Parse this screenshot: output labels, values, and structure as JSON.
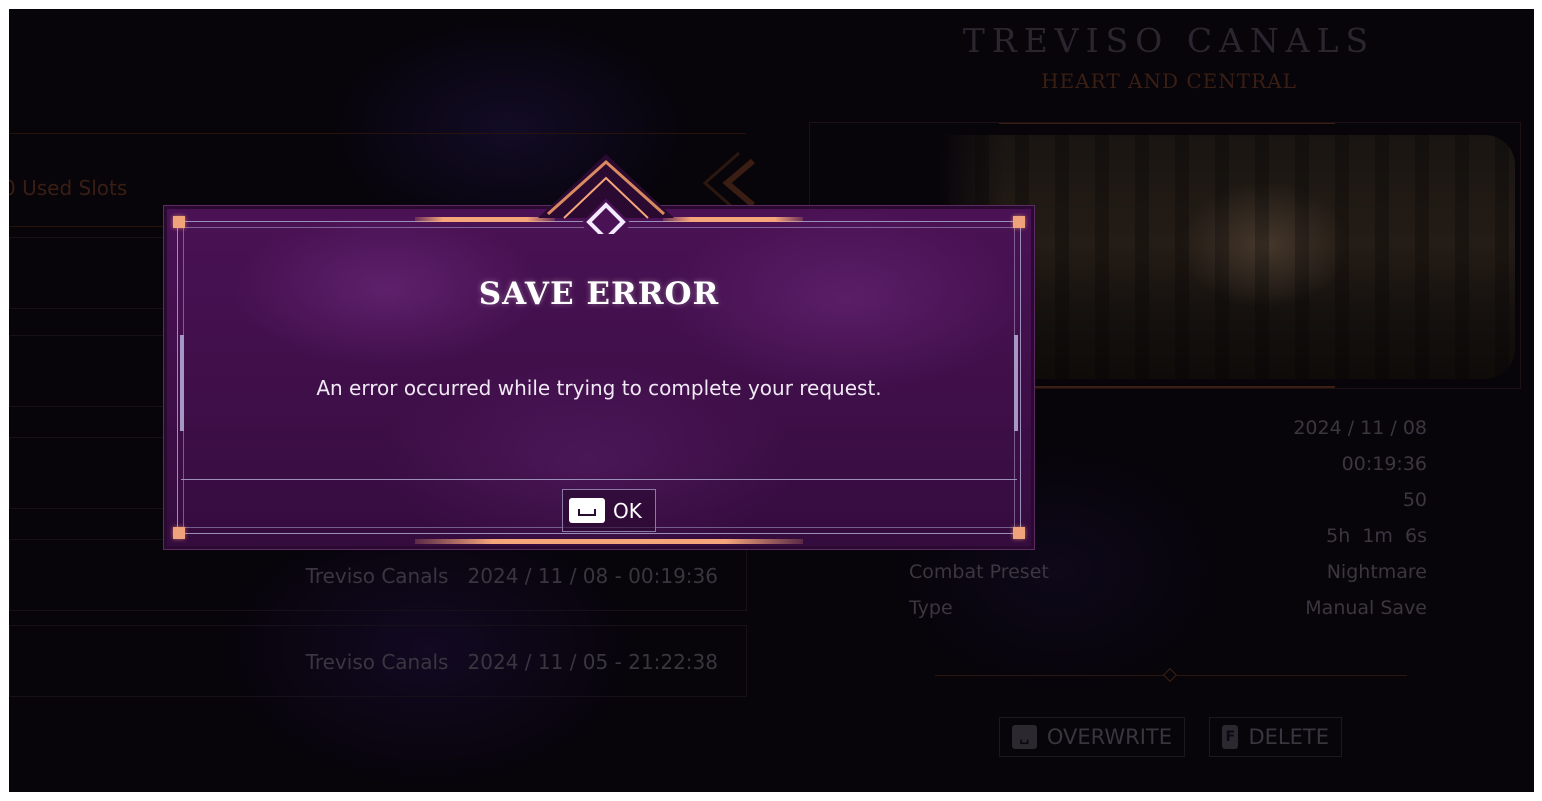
{
  "location": {
    "title": "TREVISO CANALS",
    "subtitle": "HEART AND CENTRAL"
  },
  "details": {
    "date": "2024 / 11 / 08",
    "time": "00:19:36",
    "level": "50",
    "playtime": "5h  1m  6s",
    "combat_preset_label": "Combat Preset",
    "combat_preset_value": "Nightmare",
    "type_label": "Type",
    "type_value": "Manual Save"
  },
  "actions": {
    "overwrite_label": "OVERWRITE",
    "delete_key": "F",
    "delete_label": "DELETE"
  },
  "slots": {
    "header": "0 Used Slots",
    "rows": [
      {
        "text": "Treviso Canals   2024 / 11 / 08 - 00:19:36"
      },
      {
        "text": "Treviso Canals   2024 / 11 / 05 - 21:22:38"
      }
    ]
  },
  "dialog": {
    "title": "SAVE ERROR",
    "message": "An error occurred while trying to complete your request.",
    "ok_label": "OK"
  },
  "colors": {
    "dialog_bg": "#3f0f49",
    "accent_gold": "#f4a57a",
    "frame_line": "#9a8fb8"
  }
}
